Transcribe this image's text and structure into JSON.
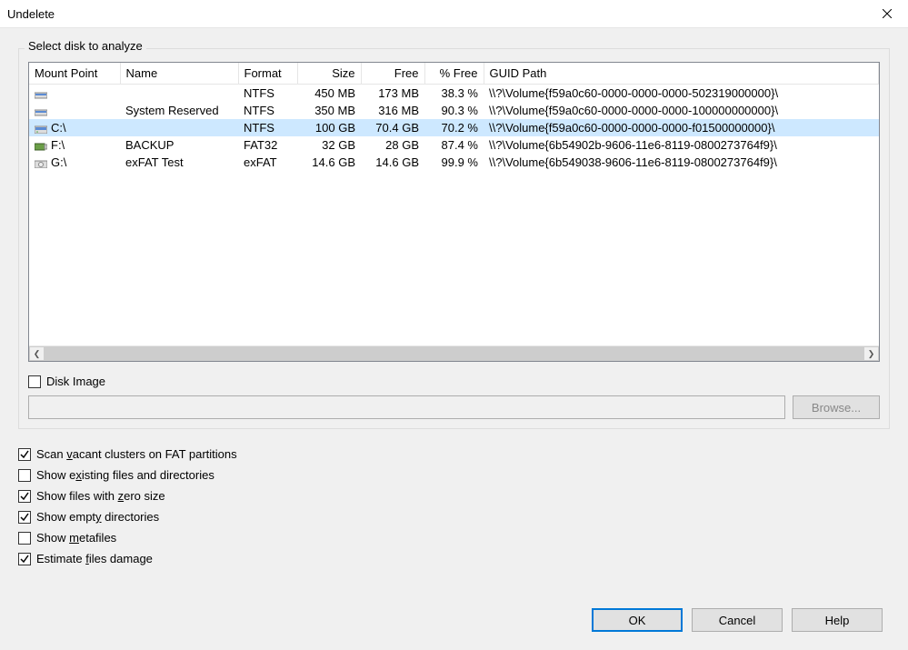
{
  "window": {
    "title": "Undelete"
  },
  "group_label": "Select disk to analyze",
  "columns": {
    "mount": "Mount Point",
    "name": "Name",
    "format": "Format",
    "size": "Size",
    "free": "Free",
    "pfree": "% Free",
    "guid": "GUID Path"
  },
  "rows": [
    {
      "mount": "",
      "name": "",
      "format": "NTFS",
      "size": "450 MB",
      "free": "173 MB",
      "pfree": "38.3 %",
      "guid": "\\\\?\\Volume{f59a0c60-0000-0000-0000-502319000000}\\",
      "icon": "hdd-sm",
      "selected": false
    },
    {
      "mount": "",
      "name": "System Reserved",
      "format": "NTFS",
      "size": "350 MB",
      "free": "316 MB",
      "pfree": "90.3 %",
      "guid": "\\\\?\\Volume{f59a0c60-0000-0000-0000-100000000000}\\",
      "icon": "hdd-sm",
      "selected": false
    },
    {
      "mount": "C:\\",
      "name": "",
      "format": "NTFS",
      "size": "100 GB",
      "free": "70.4 GB",
      "pfree": "70.2 %",
      "guid": "\\\\?\\Volume{f59a0c60-0000-0000-0000-f01500000000}\\",
      "icon": "hdd",
      "selected": true
    },
    {
      "mount": "F:\\",
      "name": "BACKUP",
      "format": "FAT32",
      "size": "32 GB",
      "free": "28 GB",
      "pfree": "87.4 %",
      "guid": "\\\\?\\Volume{6b54902b-9606-11e6-8119-0800273764f9}\\",
      "icon": "usb",
      "selected": false
    },
    {
      "mount": "G:\\",
      "name": "exFAT Test",
      "format": "exFAT",
      "size": "14.6 GB",
      "free": "14.6 GB",
      "pfree": "99.9 %",
      "guid": "\\\\?\\Volume{6b549038-9606-11e6-8119-0800273764f9}\\",
      "icon": "cd",
      "selected": false
    }
  ],
  "disk_image": {
    "label": "Disk Image",
    "checked": false,
    "path": "",
    "browse": "Browse..."
  },
  "options": [
    {
      "label_pre": "Scan ",
      "u": "v",
      "label_post": "acant clusters on FAT partitions",
      "checked": true
    },
    {
      "label_pre": "Show e",
      "u": "x",
      "label_post": "isting files and directories",
      "checked": false
    },
    {
      "label_pre": "Show files with ",
      "u": "z",
      "label_post": "ero size",
      "checked": true
    },
    {
      "label_pre": "Show empt",
      "u": "y",
      "label_post": " directories",
      "checked": true
    },
    {
      "label_pre": "Show ",
      "u": "m",
      "label_post": "etafiles",
      "checked": false
    },
    {
      "label_pre": "Estimate ",
      "u": "f",
      "label_post": "iles damage",
      "checked": true
    }
  ],
  "buttons": {
    "ok": "OK",
    "cancel": "Cancel",
    "help": "Help"
  }
}
